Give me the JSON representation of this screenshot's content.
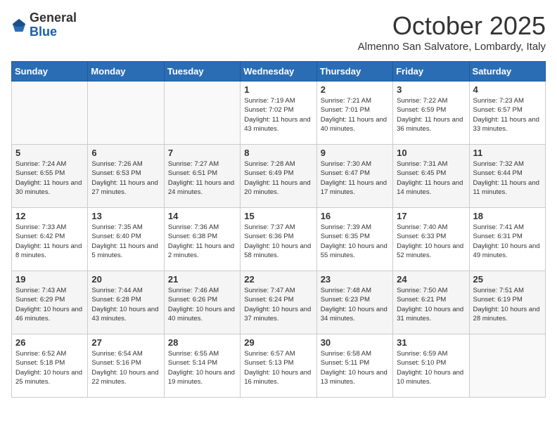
{
  "header": {
    "logo_general": "General",
    "logo_blue": "Blue",
    "month_title": "October 2025",
    "subtitle": "Almenno San Salvatore, Lombardy, Italy"
  },
  "days_of_week": [
    "Sunday",
    "Monday",
    "Tuesday",
    "Wednesday",
    "Thursday",
    "Friday",
    "Saturday"
  ],
  "weeks": [
    [
      {
        "day": "",
        "info": ""
      },
      {
        "day": "",
        "info": ""
      },
      {
        "day": "",
        "info": ""
      },
      {
        "day": "1",
        "info": "Sunrise: 7:19 AM\nSunset: 7:02 PM\nDaylight: 11 hours and 43 minutes."
      },
      {
        "day": "2",
        "info": "Sunrise: 7:21 AM\nSunset: 7:01 PM\nDaylight: 11 hours and 40 minutes."
      },
      {
        "day": "3",
        "info": "Sunrise: 7:22 AM\nSunset: 6:59 PM\nDaylight: 11 hours and 36 minutes."
      },
      {
        "day": "4",
        "info": "Sunrise: 7:23 AM\nSunset: 6:57 PM\nDaylight: 11 hours and 33 minutes."
      }
    ],
    [
      {
        "day": "5",
        "info": "Sunrise: 7:24 AM\nSunset: 6:55 PM\nDaylight: 11 hours and 30 minutes."
      },
      {
        "day": "6",
        "info": "Sunrise: 7:26 AM\nSunset: 6:53 PM\nDaylight: 11 hours and 27 minutes."
      },
      {
        "day": "7",
        "info": "Sunrise: 7:27 AM\nSunset: 6:51 PM\nDaylight: 11 hours and 24 minutes."
      },
      {
        "day": "8",
        "info": "Sunrise: 7:28 AM\nSunset: 6:49 PM\nDaylight: 11 hours and 20 minutes."
      },
      {
        "day": "9",
        "info": "Sunrise: 7:30 AM\nSunset: 6:47 PM\nDaylight: 11 hours and 17 minutes."
      },
      {
        "day": "10",
        "info": "Sunrise: 7:31 AM\nSunset: 6:45 PM\nDaylight: 11 hours and 14 minutes."
      },
      {
        "day": "11",
        "info": "Sunrise: 7:32 AM\nSunset: 6:44 PM\nDaylight: 11 hours and 11 minutes."
      }
    ],
    [
      {
        "day": "12",
        "info": "Sunrise: 7:33 AM\nSunset: 6:42 PM\nDaylight: 11 hours and 8 minutes."
      },
      {
        "day": "13",
        "info": "Sunrise: 7:35 AM\nSunset: 6:40 PM\nDaylight: 11 hours and 5 minutes."
      },
      {
        "day": "14",
        "info": "Sunrise: 7:36 AM\nSunset: 6:38 PM\nDaylight: 11 hours and 2 minutes."
      },
      {
        "day": "15",
        "info": "Sunrise: 7:37 AM\nSunset: 6:36 PM\nDaylight: 10 hours and 58 minutes."
      },
      {
        "day": "16",
        "info": "Sunrise: 7:39 AM\nSunset: 6:35 PM\nDaylight: 10 hours and 55 minutes."
      },
      {
        "day": "17",
        "info": "Sunrise: 7:40 AM\nSunset: 6:33 PM\nDaylight: 10 hours and 52 minutes."
      },
      {
        "day": "18",
        "info": "Sunrise: 7:41 AM\nSunset: 6:31 PM\nDaylight: 10 hours and 49 minutes."
      }
    ],
    [
      {
        "day": "19",
        "info": "Sunrise: 7:43 AM\nSunset: 6:29 PM\nDaylight: 10 hours and 46 minutes."
      },
      {
        "day": "20",
        "info": "Sunrise: 7:44 AM\nSunset: 6:28 PM\nDaylight: 10 hours and 43 minutes."
      },
      {
        "day": "21",
        "info": "Sunrise: 7:46 AM\nSunset: 6:26 PM\nDaylight: 10 hours and 40 minutes."
      },
      {
        "day": "22",
        "info": "Sunrise: 7:47 AM\nSunset: 6:24 PM\nDaylight: 10 hours and 37 minutes."
      },
      {
        "day": "23",
        "info": "Sunrise: 7:48 AM\nSunset: 6:23 PM\nDaylight: 10 hours and 34 minutes."
      },
      {
        "day": "24",
        "info": "Sunrise: 7:50 AM\nSunset: 6:21 PM\nDaylight: 10 hours and 31 minutes."
      },
      {
        "day": "25",
        "info": "Sunrise: 7:51 AM\nSunset: 6:19 PM\nDaylight: 10 hours and 28 minutes."
      }
    ],
    [
      {
        "day": "26",
        "info": "Sunrise: 6:52 AM\nSunset: 5:18 PM\nDaylight: 10 hours and 25 minutes."
      },
      {
        "day": "27",
        "info": "Sunrise: 6:54 AM\nSunset: 5:16 PM\nDaylight: 10 hours and 22 minutes."
      },
      {
        "day": "28",
        "info": "Sunrise: 6:55 AM\nSunset: 5:14 PM\nDaylight: 10 hours and 19 minutes."
      },
      {
        "day": "29",
        "info": "Sunrise: 6:57 AM\nSunset: 5:13 PM\nDaylight: 10 hours and 16 minutes."
      },
      {
        "day": "30",
        "info": "Sunrise: 6:58 AM\nSunset: 5:11 PM\nDaylight: 10 hours and 13 minutes."
      },
      {
        "day": "31",
        "info": "Sunrise: 6:59 AM\nSunset: 5:10 PM\nDaylight: 10 hours and 10 minutes."
      },
      {
        "day": "",
        "info": ""
      }
    ]
  ]
}
